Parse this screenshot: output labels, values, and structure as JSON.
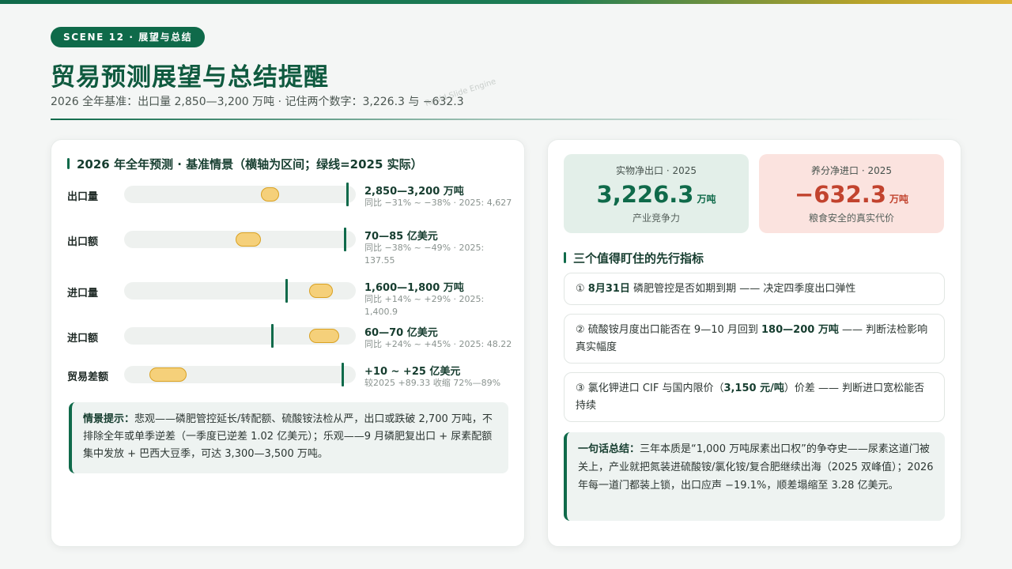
{
  "header": {
    "scene": "SCENE 12 · 展望与总结",
    "title": "贸易预测展望与总结提醒",
    "subtitle": "2026 全年基准：出口量 2,850—3,200 万吨 · 记住两个数字：3,226.3 与 −632.3",
    "watermark": "Rapid Slide Engine"
  },
  "forecast": {
    "title": "2026 年全年预测 · 基准情景（横轴为区间；绿线=2025 实际）",
    "rows": [
      {
        "label": "出口量",
        "range_start": 0.59,
        "range_end": 0.67,
        "actual": 0.965,
        "main": "2,850—3,200 万吨",
        "sub": "同比 −31% ~ −38% · 2025: 4,627"
      },
      {
        "label": "出口额",
        "range_start": 0.48,
        "range_end": 0.59,
        "actual": 0.955,
        "main": "70—85 亿美元",
        "sub": "同比 −38% ~ −49% · 2025: 137.55"
      },
      {
        "label": "进口量",
        "range_start": 0.8,
        "range_end": 0.9,
        "actual": 0.7,
        "main": "1,600—1,800 万吨",
        "sub": "同比 +14% ~ +29% · 2025: 1,400.9"
      },
      {
        "label": "进口额",
        "range_start": 0.8,
        "range_end": 0.93,
        "actual": 0.64,
        "main": "60—70 亿美元",
        "sub": "同比 +24% ~ +45% · 2025: 48.22"
      },
      {
        "label": "贸易差额",
        "range_start": 0.11,
        "range_end": 0.27,
        "actual": 0.945,
        "main": "+10 ~ +25 亿美元",
        "sub": "较2025 +89.33 收缩 72%—89%"
      }
    ],
    "hint_title": "情景提示：",
    "hint_text": "悲观——磷肥管控延长/转配额、硫酸铵法检从严，出口或跌破 2,700 万吨，不排除全年或单季逆差（一季度已逆差 1.02 亿美元）；乐观——9 月磷肥复出口 + 尿素配额集中发放 + 巴西大豆季，可达 3,300—3,500 万吨。"
  },
  "stats": {
    "net_export": {
      "label": "实物净出口 · 2025",
      "value": "3,226.3",
      "unit": "万吨",
      "caption": "产业竞争力"
    },
    "net_import": {
      "label": "养分净进口 · 2025",
      "value": "−632.3",
      "unit": "万吨",
      "caption": "粮食安全的真实代价"
    }
  },
  "indicators": {
    "title": "三个值得盯住的先行指标",
    "items": [
      {
        "prefix": "① ",
        "bold": "8月31日",
        "text": " 磷肥管控是否如期到期 —— 决定四季度出口弹性",
        "bold2": "",
        "tail": ""
      },
      {
        "prefix": "② ",
        "bold": "",
        "text": "硫酸铵月度出口能否在 9—10 月回到 ",
        "bold2": "180—200 万吨",
        "tail": " —— 判断法检影响真实幅度"
      },
      {
        "prefix": "③ ",
        "bold": "",
        "text": "氯化钾进口 CIF 与国内限价（",
        "bold2": "3,150 元/吨",
        "tail": "）价差 —— 判断进口宽松能否持续"
      }
    ]
  },
  "summary": {
    "title": "一句话总结：",
    "text": "三年本质是“1,000 万吨尿素出口权”的争夺史——尿素这道门被关上，产业就把氮装进硫酸铵/氯化铵/复合肥继续出海（2025 双峰值）；2026 年每一道门都装上锁，出口应声 −19.1%，顺差塌缩至 3.28 亿美元。"
  },
  "colors": {
    "accent": "#0f6a4a",
    "range_fill": "#f5d07a",
    "negative": "#c2432e"
  }
}
